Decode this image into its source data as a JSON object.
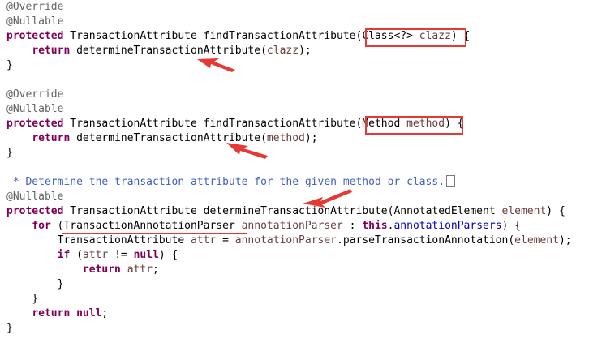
{
  "editor": {
    "lines": [
      [
        {
          "t": "@Override",
          "c": "ann"
        }
      ],
      [
        {
          "t": "@Nullable",
          "c": "ann"
        }
      ],
      [
        {
          "t": "protected",
          "c": "kw"
        },
        {
          "t": " TransactionAttribute findTransactionAttribute("
        },
        {
          "t": "Class<?> "
        },
        {
          "t": "clazz",
          "c": "var"
        },
        {
          "t": ") {"
        }
      ],
      [
        {
          "t": "    "
        },
        {
          "t": "return",
          "c": "kw"
        },
        {
          "t": " determineTransactionAttribute("
        },
        {
          "t": "clazz",
          "c": "var"
        },
        {
          "t": ");"
        }
      ],
      [
        {
          "t": "}"
        }
      ],
      [],
      [
        {
          "t": "@Override",
          "c": "ann"
        }
      ],
      [
        {
          "t": "@Nullable",
          "c": "ann"
        }
      ],
      [
        {
          "t": "protected",
          "c": "kw"
        },
        {
          "t": " TransactionAttribute findTransactionAttribute("
        },
        {
          "t": "Method "
        },
        {
          "t": "method",
          "c": "var"
        },
        {
          "t": ") {"
        }
      ],
      [
        {
          "t": "    "
        },
        {
          "t": "return",
          "c": "kw"
        },
        {
          "t": " determineTransactionAttribute("
        },
        {
          "t": "method",
          "c": "var"
        },
        {
          "t": ");"
        }
      ],
      [
        {
          "t": "}"
        }
      ],
      [],
      [
        {
          "t": " * Determine the transaction attribute for the given method or class.",
          "c": "doc"
        },
        {
          "t": "",
          "c": "more"
        }
      ],
      [
        {
          "t": "@Nullable",
          "c": "ann"
        }
      ],
      [
        {
          "t": "protected",
          "c": "kw"
        },
        {
          "t": " TransactionAttribute determineTransactionAttribute(AnnotatedElement "
        },
        {
          "t": "element",
          "c": "var"
        },
        {
          "t": ") {"
        }
      ],
      [
        {
          "t": "    "
        },
        {
          "t": "for",
          "c": "kw"
        },
        {
          "t": " (TransactionAnnotationParser "
        },
        {
          "t": "annotationParser",
          "c": "var"
        },
        {
          "t": " : "
        },
        {
          "t": "this",
          "c": "kw"
        },
        {
          "t": "."
        },
        {
          "t": "annotationParsers",
          "c": "fld"
        },
        {
          "t": ") {"
        }
      ],
      [
        {
          "t": "        TransactionAttribute "
        },
        {
          "t": "attr",
          "c": "var"
        },
        {
          "t": " = "
        },
        {
          "t": "annotationParser",
          "c": "var"
        },
        {
          "t": ".parseTransactionAnnotation("
        },
        {
          "t": "element",
          "c": "var"
        },
        {
          "t": ");"
        }
      ],
      [
        {
          "t": "        "
        },
        {
          "t": "if",
          "c": "kw"
        },
        {
          "t": " ("
        },
        {
          "t": "attr",
          "c": "var"
        },
        {
          "t": " != "
        },
        {
          "t": "null",
          "c": "kw"
        },
        {
          "t": ") {"
        }
      ],
      [
        {
          "t": "            "
        },
        {
          "t": "return",
          "c": "kw"
        },
        {
          "t": " "
        },
        {
          "t": "attr",
          "c": "var"
        },
        {
          "t": ";"
        }
      ],
      [
        {
          "t": "        }"
        }
      ],
      [
        {
          "t": "    }"
        }
      ],
      [
        {
          "t": "    "
        },
        {
          "t": "return",
          "c": "kw"
        },
        {
          "t": " "
        },
        {
          "t": "null",
          "c": "kw"
        },
        {
          "t": ";"
        }
      ],
      [
        {
          "t": "}"
        }
      ]
    ]
  },
  "colors": {
    "keyword": "#7f0055",
    "annotation": "#646464",
    "variable": "#6a3e3e",
    "field": "#0000c0",
    "javadoc": "#3f5fbf",
    "markup": "#e53935"
  }
}
